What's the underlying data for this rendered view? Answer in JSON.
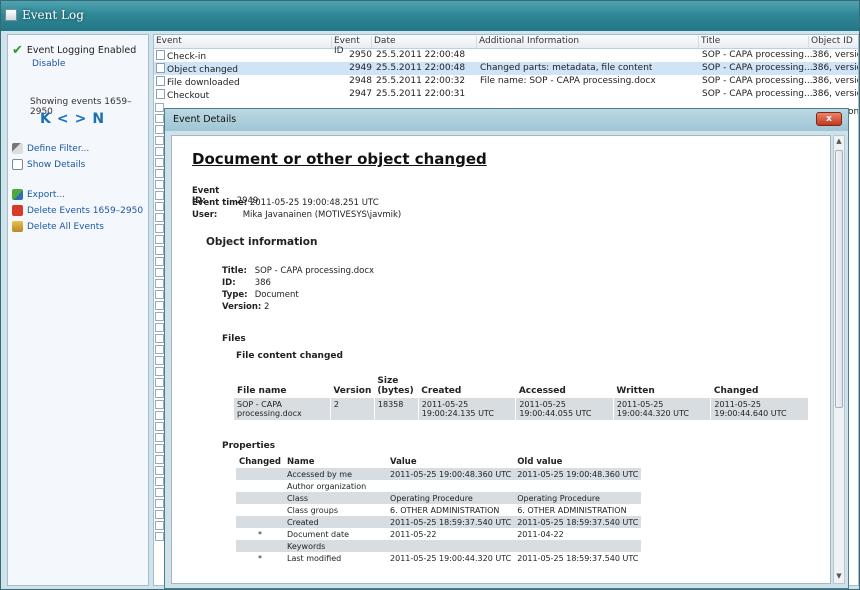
{
  "window": {
    "title": "Event Log"
  },
  "left_panel": {
    "status": "Event Logging Enabled",
    "disable": "Disable",
    "showing": "Showing events 1659–2950",
    "nav": [
      "K",
      "<",
      ">",
      "N"
    ],
    "define_filter": "Define Filter...",
    "show_details": "Show Details",
    "export": "Export...",
    "delete_range": "Delete Events 1659–2950",
    "delete_all": "Delete All Events"
  },
  "events": {
    "columns": [
      "Event",
      "Event ID",
      "Date",
      "Additional Information",
      "Title",
      "Object ID"
    ],
    "rows": [
      {
        "event": "Check-in",
        "id": "2950",
        "date": "25.5.2011 22:00:48",
        "info": "",
        "title": "SOP - CAPA processing....",
        "obj": "386, version"
      },
      {
        "event": "Object changed",
        "id": "2949",
        "date": "25.5.2011 22:00:48",
        "info": "Changed parts: metadata, file content",
        "title": "SOP - CAPA processing....",
        "obj": "386, version"
      },
      {
        "event": "File downloaded",
        "id": "2948",
        "date": "25.5.2011 22:00:32",
        "info": "File name: SOP - CAPA processing.docx",
        "title": "SOP - CAPA processing....",
        "obj": "386, version"
      },
      {
        "event": "Checkout",
        "id": "2947",
        "date": "25.5.2011 22:00:31",
        "info": "",
        "title": "SOP - CAPA processing....",
        "obj": "386, version"
      }
    ],
    "overflow_text": "on"
  },
  "dialog": {
    "title": "Event Details",
    "close": "x",
    "heading": "Document or other object changed",
    "event_id_label": "Event ID:",
    "event_id": "2949",
    "event_time_label": "Event time:",
    "event_time": "2011-05-25 19:00:48.251 UTC",
    "user_label": "User:",
    "user": "Mika Javanainen (MOTIVESYS\\javmik)",
    "object_info": "Object information",
    "obj_title_label": "Title:",
    "obj_title": "SOP - CAPA processing.docx",
    "obj_id_label": "ID:",
    "obj_id": "386",
    "obj_type_label": "Type:",
    "obj_type": "Document",
    "obj_version_label": "Version:",
    "obj_version": "2",
    "files": "Files",
    "file_content_changed": "File content changed",
    "files_table": {
      "headers": [
        "File name",
        "Version",
        "Size (bytes)",
        "Created",
        "Accessed",
        "Written",
        "Changed"
      ],
      "row": [
        "SOP - CAPA processing.docx",
        "2",
        "18358",
        "2011-05-25 19:00:24.135 UTC",
        "2011-05-25 19:00:44.055 UTC",
        "2011-05-25 19:00:44.320 UTC",
        "2011-05-25 19:00:44.640 UTC"
      ]
    },
    "properties": "Properties",
    "props_table": {
      "headers": [
        "Changed",
        "Name",
        "Value",
        "Old value"
      ],
      "rows": [
        {
          "changed": "",
          "name": "Accessed by me",
          "value": "2011-05-25 19:00:48.360 UTC",
          "old": "2011-05-25 19:00:48.360 UTC"
        },
        {
          "changed": "",
          "name": "Author organization",
          "value": "",
          "old": ""
        },
        {
          "changed": "",
          "name": "Class",
          "value": "Operating Procedure",
          "old": "Operating Procedure"
        },
        {
          "changed": "",
          "name": "Class groups",
          "value": "6. OTHER ADMINISTRATION",
          "old": "6. OTHER ADMINISTRATION"
        },
        {
          "changed": "",
          "name": "Created",
          "value": "2011-05-25 18:59:37.540 UTC",
          "old": "2011-05-25 18:59:37.540 UTC"
        },
        {
          "changed": "*",
          "name": "Document date",
          "value": "2011-05-22",
          "old": "2011-04-22"
        },
        {
          "changed": "",
          "name": "Keywords",
          "value": "",
          "old": ""
        },
        {
          "changed": "*",
          "name": "Last modified",
          "value": "2011-05-25 19:00:44.320 UTC",
          "old": "2011-05-25 18:59:37.540 UTC"
        }
      ]
    }
  },
  "icons": {
    "check": "check-icon",
    "filter": "filter-icon",
    "details": "details-icon",
    "export": "export-icon",
    "delete_range": "delete-range-icon",
    "delete_all": "delete-all-icon"
  }
}
